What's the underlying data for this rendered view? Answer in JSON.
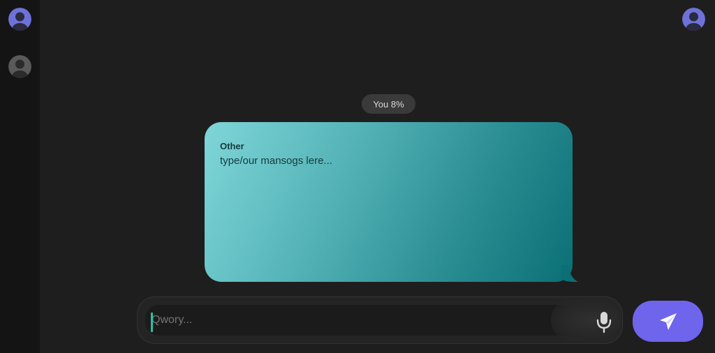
{
  "conversation": {
    "timestamp": "You 8%"
  },
  "message": {
    "sender": "Other",
    "text": "type/our mansogs lere..."
  },
  "composer": {
    "placeholder": "Qwory..."
  },
  "icons": {
    "self_avatar": "user-avatar-icon",
    "contact_avatar": "user-avatar-icon",
    "profile_avatar": "user-avatar-icon",
    "mic": "microphone-icon",
    "send": "airplane-send-icon"
  },
  "colors": {
    "accent": "#6f64ec",
    "bubble_start": "#7fd6d8",
    "bubble_end": "#0b6f76",
    "caret": "#28c2a8"
  }
}
